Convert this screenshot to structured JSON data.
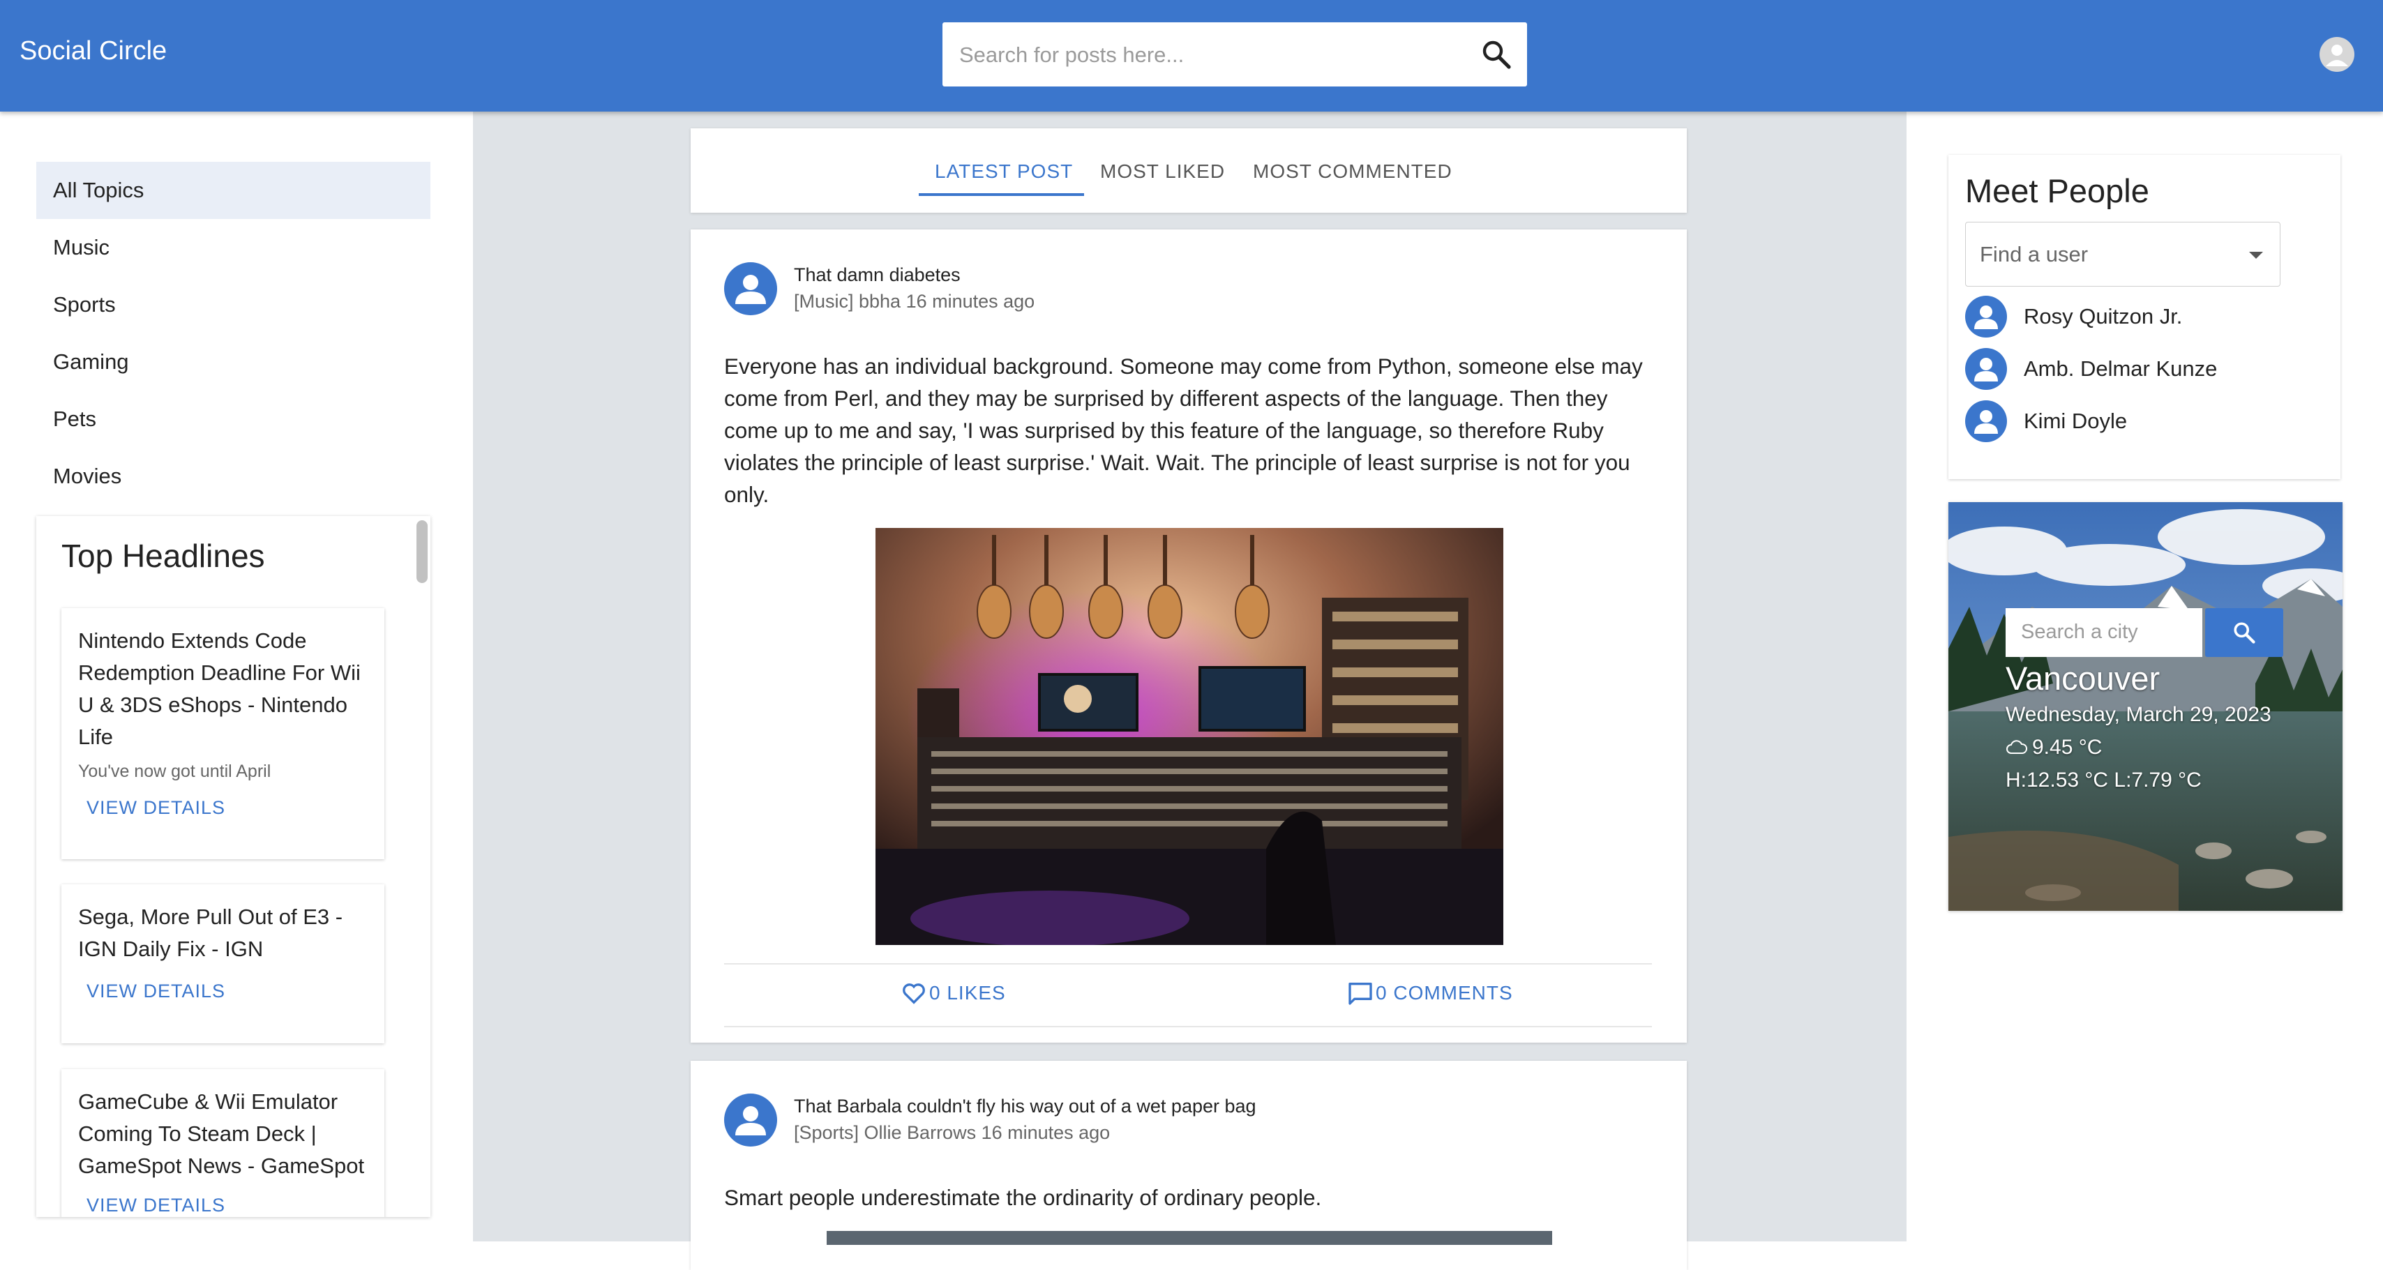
{
  "app": {
    "title": "Social Circle"
  },
  "search": {
    "placeholder": "Search for posts here..."
  },
  "sidebar": {
    "topics": [
      "All Topics",
      "Music",
      "Sports",
      "Gaming",
      "Pets",
      "Movies"
    ],
    "active_topic": "All Topics"
  },
  "headlines": {
    "title": "Top Headlines",
    "items": [
      {
        "title": "Nintendo Extends Code Redemption Deadline For Wii U & 3DS eShops - Nintendo Life",
        "description": "You've now got until April",
        "action": "VIEW DETAILS"
      },
      {
        "title": "Sega, More Pull Out of E3 - IGN Daily Fix - IGN",
        "description": "",
        "action": "VIEW DETAILS"
      },
      {
        "title": "GameCube & Wii Emulator Coming To Steam Deck | GameSpot News - GameSpot",
        "description": "",
        "action": "VIEW DETAILS"
      }
    ]
  },
  "tabs": [
    {
      "label": "LATEST POST",
      "active": true
    },
    {
      "label": "MOST LIKED",
      "active": false
    },
    {
      "label": "MOST COMMENTED",
      "active": false
    }
  ],
  "posts": [
    {
      "title": "That damn diabetes",
      "meta": "[Music] bbha 16 minutes ago",
      "body": "Everyone has an individual background. Someone may come from Python, someone else may come from Perl, and they may be surprised by different aspects of the language. Then they come up to me and say, 'I was surprised by this feature of the language, so therefore Ruby violates the principle of least surprise.' Wait. Wait. The principle of least surprise is not for you only.",
      "likes": "0 LIKES",
      "comments": "0 COMMENTS"
    },
    {
      "title": "That Barbala couldn't fly his way out of a wet paper bag",
      "meta": "[Sports] Ollie Barrows 16 minutes ago",
      "body": "Smart people underestimate the ordinarity of ordinary people."
    }
  ],
  "meet": {
    "title": "Meet People",
    "find_placeholder": "Find a user",
    "people": [
      "Rosy Quitzon Jr.",
      "Amb. Delmar Kunze",
      "Kimi Doyle"
    ]
  },
  "weather": {
    "search_placeholder": "Search a city",
    "city": "Vancouver",
    "date": "Wednesday, March 29, 2023",
    "temp": "9.45 °C",
    "hilo": "H:12.53 °C L:7.79 °C"
  },
  "colors": {
    "primary": "#3b76cc",
    "center_bg": "#dfe3e7",
    "active_topic_bg": "#e9eef7"
  }
}
